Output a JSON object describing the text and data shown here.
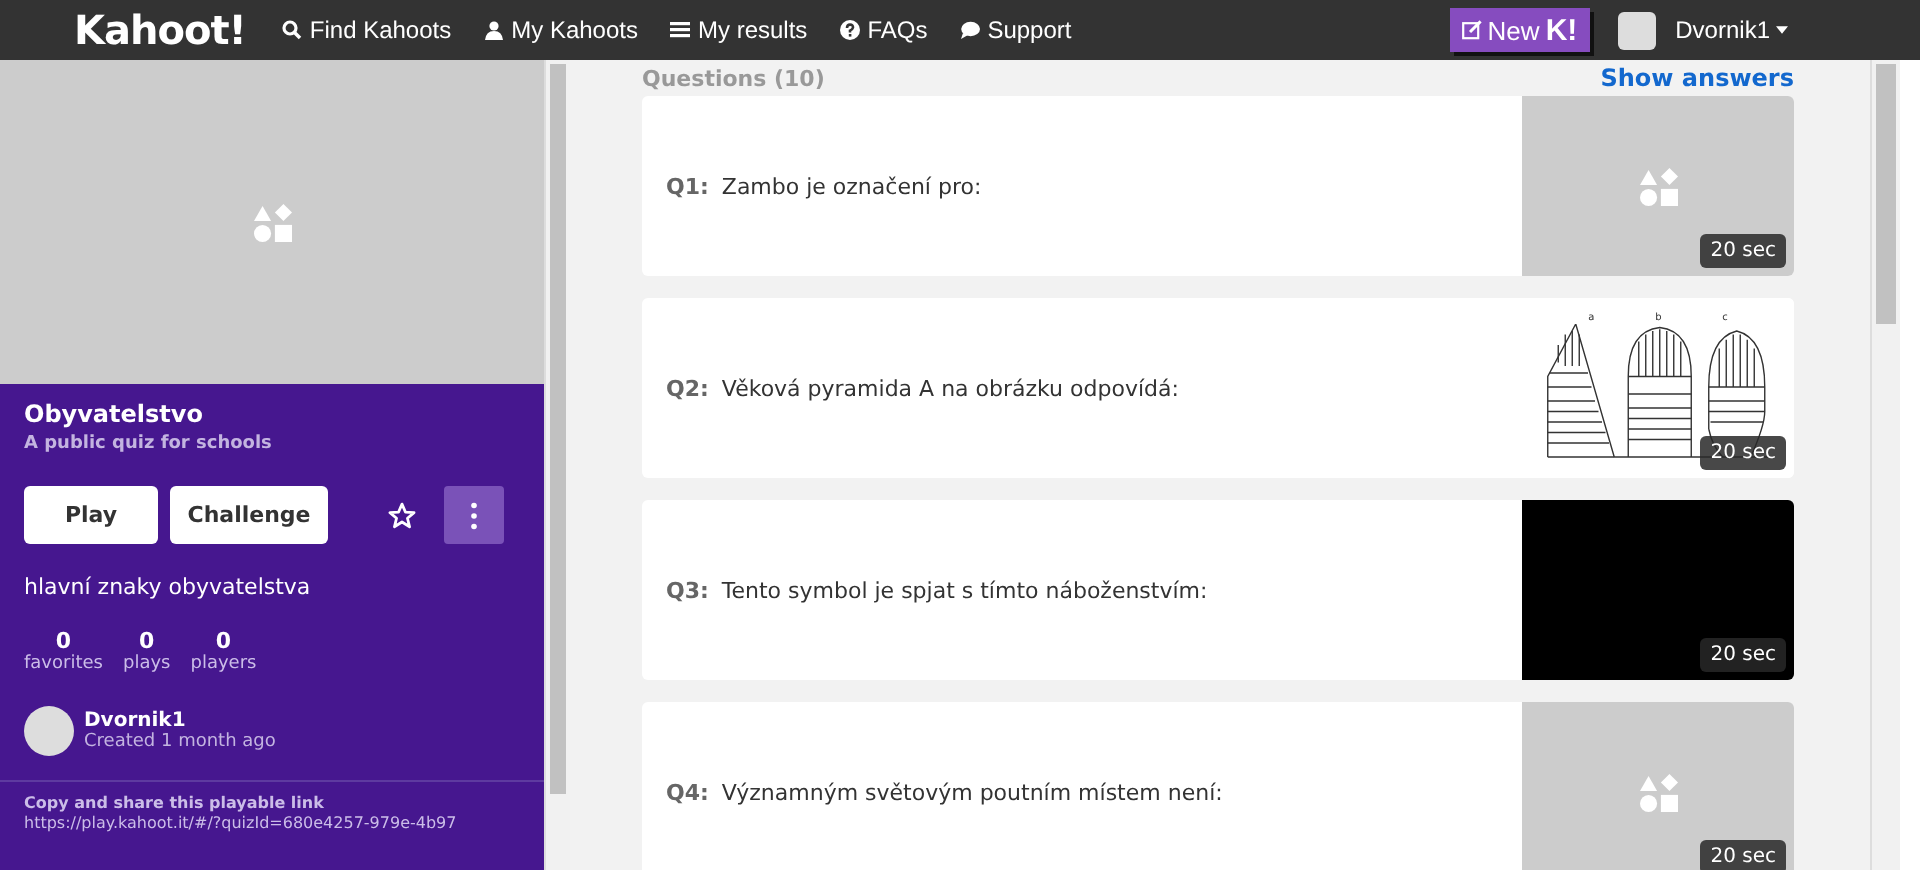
{
  "nav": {
    "logo": "Kahoot!",
    "links": [
      {
        "label": "Find Kahoots",
        "kind": "search"
      },
      {
        "label": "My Kahoots",
        "kind": "user"
      },
      {
        "label": "My results",
        "kind": "list"
      },
      {
        "label": "FAQs",
        "kind": "help"
      },
      {
        "label": "Support",
        "kind": "chat"
      }
    ],
    "new_button": {
      "label": "New",
      "logo": "K!"
    },
    "user": "Dvornik1"
  },
  "quiz": {
    "title": "Obyvatelstvo",
    "subtitle": "A public quiz for schools",
    "play": "Play",
    "challenge": "Challenge",
    "favorite": false,
    "description": "hlavní znaky obyvatelstva",
    "stats": [
      {
        "value": "0",
        "label": "favorites"
      },
      {
        "value": "0",
        "label": "plays"
      },
      {
        "value": "0",
        "label": "players"
      }
    ],
    "author": "Dvornik1",
    "created": "Created 1 month ago",
    "share_title": "Copy and share this playable link",
    "share_link": "https://play.kahoot.it/#/?quizId=680e4257-979e-4b97"
  },
  "questions_header": {
    "title": "Questions (10)",
    "show_answers": "Show answers"
  },
  "questions": [
    {
      "number": "Q1:",
      "text": "Zambo je označení pro:",
      "image": {
        "kind": "placeholder"
      },
      "time": "20 sec"
    },
    {
      "number": "Q2:",
      "text": "Věková pyramida A na obrázku odpovídá:",
      "image": {
        "kind": "drawing",
        "labels": [
          "a",
          "b",
          "c"
        ]
      },
      "time": "20 sec"
    },
    {
      "number": "Q3:",
      "text": "Tento symbol je spjat s tímto náboženstvím:",
      "image": {
        "kind": "blank"
      },
      "time": "20 sec"
    },
    {
      "number": "Q4:",
      "text": "Významným světovým poutním místem není:",
      "image": {
        "kind": "placeholder"
      },
      "time": "20 sec"
    }
  ]
}
